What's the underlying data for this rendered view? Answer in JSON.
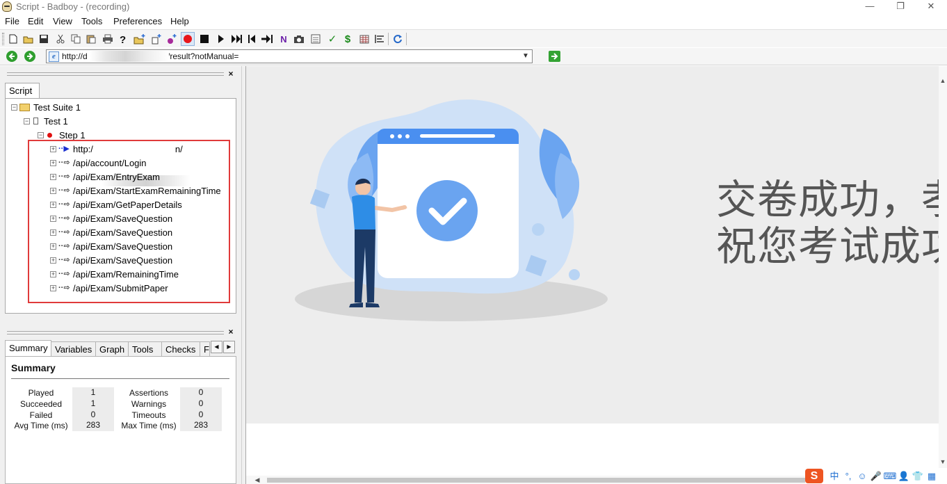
{
  "window": {
    "title": "Script - Badboy - (recording)",
    "controls": {
      "minimize": "—",
      "restore": "❐",
      "close": "✕"
    }
  },
  "menu": [
    "File",
    "Edit",
    "View",
    "Tools",
    "Preferences",
    "Help"
  ],
  "toolbar": {
    "icons": [
      "new-document-icon",
      "open-folder-icon",
      "save-icon",
      "cut-icon",
      "copy-icon",
      "paste-icon",
      "print-icon",
      "help-icon",
      "add-folder-icon",
      "add-item-icon",
      "add-request-icon",
      "record-icon",
      "stop-icon",
      "play-icon",
      "fast-forward-icon",
      "skip-back-icon",
      "step-forward-icon",
      "navigation-icon",
      "camera-icon",
      "clear-icon",
      "check-icon",
      "variable-icon",
      "table-icon",
      "align-icon",
      "refresh-icon"
    ],
    "glyphs": {
      "n_label": "N",
      "check_label": "✓",
      "dollar_label": "$"
    }
  },
  "address": {
    "url": "http://d                          ./result?notManual=",
    "url_prefix": "http://d",
    "url_suffix": "./result?notManual="
  },
  "script_panel": {
    "tab_label": "Script",
    "tree": {
      "suite": "Test Suite 1",
      "test": "Test 1",
      "step": "Step 1",
      "requests": [
        "http:/                          .n/",
        "/api/account/Login",
        "/api/Exam/EntryExam",
        "/api/Exam/StartExamRemainingTime",
        "/api/Exam/GetPaperDetails",
        "/api/Exam/SaveQuestion",
        "/api/Exam/SaveQuestion",
        "/api/Exam/SaveQuestion",
        "/api/Exam/SaveQuestion",
        "/api/Exam/RemainingTime",
        "/api/Exam/SubmitPaper"
      ],
      "first_request_prefix": "http:/",
      "first_request_suffix": "n/"
    },
    "highlight_color": "#e03a3a"
  },
  "bottom_panel": {
    "tabs": [
      "Summary",
      "Variables",
      "Graph",
      "Tools",
      "Checks",
      "F"
    ],
    "active_tab": "Summary",
    "scroll_left": "◀",
    "scroll_right": "▶",
    "summary": {
      "heading": "Summary",
      "stats": [
        {
          "label": "Played",
          "value": "1",
          "label2": "Assertions",
          "value2": "0"
        },
        {
          "label": "Succeeded",
          "value": "1",
          "label2": "Warnings",
          "value2": "0"
        },
        {
          "label": "Failed",
          "value": "0",
          "label2": "Timeouts",
          "value2": "0"
        },
        {
          "label": "Avg Time (ms)",
          "value": "283",
          "label2": "Max Time (ms)",
          "value2": "283"
        }
      ]
    }
  },
  "browser": {
    "message_line_1": "交卷成功，孝",
    "message_line_2": "祝您考试成功",
    "colors": {
      "accent_blue": "#4a8ff0",
      "blob_light": "#cfe1f7",
      "shadow": "#d6d6d6",
      "background": "#ededed"
    }
  },
  "ime": {
    "logo": "S",
    "mode": "中",
    "punct": "°,",
    "emoji": "☺",
    "mic": "🎤",
    "keyboard": "⌨",
    "user": "👤",
    "shirt": "👕",
    "grid": "▦"
  }
}
